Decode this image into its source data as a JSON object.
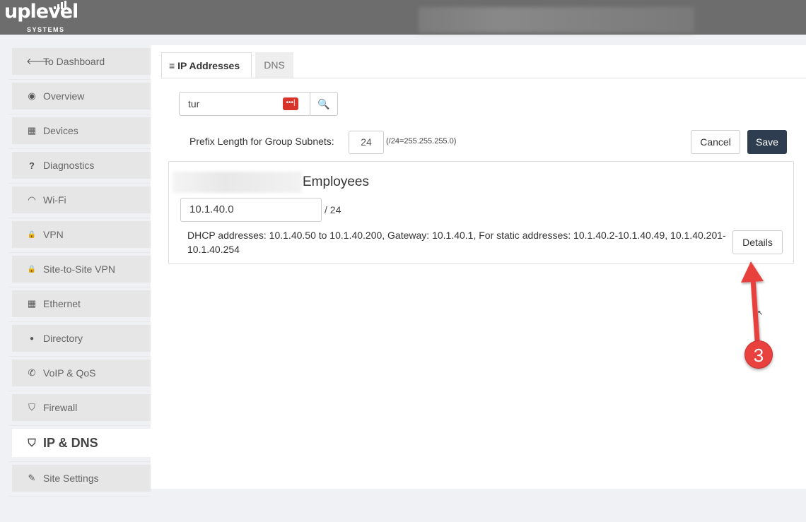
{
  "header": {
    "logo_word": "uplevel",
    "logo_sub": "SYSTEMS"
  },
  "sidebar": {
    "items": [
      {
        "label": "To Dashboard",
        "icon": "arrow-left-icon",
        "glyph": "🡐"
      },
      {
        "label": "Overview",
        "icon": "eye-icon",
        "glyph": "◉"
      },
      {
        "label": "Devices",
        "icon": "building-icon",
        "glyph": "▦"
      },
      {
        "label": "Diagnostics",
        "icon": "question-icon",
        "glyph": "?"
      },
      {
        "label": "Wi-Fi",
        "icon": "wifi-icon",
        "glyph": "◠"
      },
      {
        "label": "VPN",
        "icon": "lock-icon",
        "glyph": "🔒"
      },
      {
        "label": "Site-to-Site VPN",
        "icon": "lock-icon",
        "glyph": "🔒"
      },
      {
        "label": "Ethernet",
        "icon": "building-icon",
        "glyph": "▦"
      },
      {
        "label": "Directory",
        "icon": "user-icon",
        "glyph": "●"
      },
      {
        "label": "VoIP & QoS",
        "icon": "phone-icon",
        "glyph": "✆"
      },
      {
        "label": "Firewall",
        "icon": "shield-icon",
        "glyph": "⛉"
      },
      {
        "label": "IP & DNS",
        "icon": "shield-icon",
        "glyph": "⛉"
      },
      {
        "label": "Site Settings",
        "icon": "edit-icon",
        "glyph": "✎"
      }
    ]
  },
  "tabs": [
    {
      "label": "IP Addresses",
      "icon": "list-icon",
      "glyph": "≡"
    },
    {
      "label": "DNS"
    }
  ],
  "search": {
    "value": "tur",
    "kb_icon": "password-manager-icon",
    "kb_glyph": "•••|",
    "button_icon": "search-icon",
    "button_glyph": "🔍"
  },
  "prefix": {
    "label": "Prefix Length for Group Subnets:",
    "value": "24",
    "hint": "(/24=255.255.255.0)"
  },
  "actions": {
    "cancel": "Cancel",
    "save": "Save"
  },
  "group": {
    "name": "Employees",
    "network": "10.1.40.0",
    "suffix": "/ 24",
    "description": "DHCP addresses: 10.1.40.50 to 10.1.40.200, Gateway: 10.1.40.1, For static addresses: 10.1.40.2-10.1.40.49, 10.1.40.201-10.1.40.254",
    "details_label": "Details"
  },
  "annotation": {
    "number": "3",
    "color": "#e8413e"
  }
}
